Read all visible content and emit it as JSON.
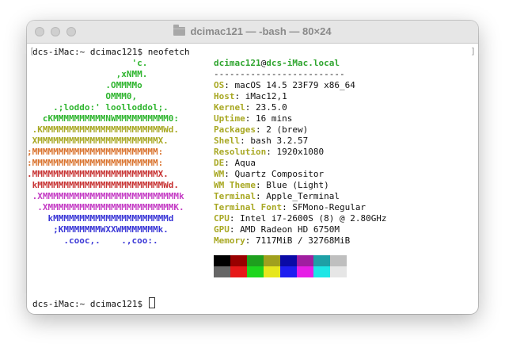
{
  "window": {
    "title": "dcimac121 — -bash — 80×24",
    "colors": {
      "titlebar": "#e6e6e6",
      "background": "#ffffff"
    }
  },
  "terminal": {
    "prompt_line": "dcs-iMac:~ dcimac121$ neofetch",
    "bracket_left": "[",
    "bracket_right": "]",
    "final_prompt": "dcs-iMac:~ dcimac121$",
    "art": [
      {
        "text": "                    'c.",
        "color": "#2fb52f"
      },
      {
        "text": "                 ,xNMM.",
        "color": "#2fb52f"
      },
      {
        "text": "               .OMMMMo",
        "color": "#2fb52f"
      },
      {
        "text": "               OMMM0,",
        "color": "#2fb52f"
      },
      {
        "text": "     .;loddo:' loolloddol;.",
        "color": "#2fb52f"
      },
      {
        "text": "   cKMMMMMMMMMMNWMMMMMMMMMM0:",
        "color": "#2fb52f"
      },
      {
        "text": " .KMMMMMMMMMMMMMMMMMMMMMMMWd.",
        "color": "#a8a823"
      },
      {
        "text": " XMMMMMMMMMMMMMMMMMMMMMMMX.",
        "color": "#a8a823"
      },
      {
        "text": ";MMMMMMMMMMMMMMMMMMMMMMMM:",
        "color": "#d9722c"
      },
      {
        "text": ":MMMMMMMMMMMMMMMMMMMMMMMM:",
        "color": "#d9722c"
      },
      {
        "text": ".MMMMMMMMMMMMMMMMMMMMMMMMX.",
        "color": "#c73232"
      },
      {
        "text": " kMMMMMMMMMMMMMMMMMMMMMMMMWd.",
        "color": "#c73232"
      },
      {
        "text": " .XMMMMMMMMMMMMMMMMMMMMMMMMMMk",
        "color": "#c43bc4"
      },
      {
        "text": "  .XMMMMMMMMMMMMMMMMMMMMMMMMK.",
        "color": "#c43bc4"
      },
      {
        "text": "    kMMMMMMMMMMMMMMMMMMMMMMd",
        "color": "#3a37d6"
      },
      {
        "text": "     ;KMMMMMMMWXXWMMMMMMMk.",
        "color": "#3a37d6"
      },
      {
        "text": "       .cooc,.    .,coo:.",
        "color": "#3a37d6"
      }
    ],
    "info": {
      "user": "dcimac121",
      "at": "@",
      "host": "dcs-iMac.local",
      "separator": "-------------------------",
      "rows": [
        {
          "key": "OS",
          "value": "macOS 14.5 23F79 x86_64"
        },
        {
          "key": "Host",
          "value": "iMac12,1"
        },
        {
          "key": "Kernel",
          "value": "23.5.0"
        },
        {
          "key": "Uptime",
          "value": "16 mins"
        },
        {
          "key": "Packages",
          "value": "2 (brew)"
        },
        {
          "key": "Shell",
          "value": "bash 3.2.57"
        },
        {
          "key": "Resolution",
          "value": "1920x1080"
        },
        {
          "key": "DE",
          "value": "Aqua"
        },
        {
          "key": "WM",
          "value": "Quartz Compositor"
        },
        {
          "key": "WM Theme",
          "value": "Blue (Light)"
        },
        {
          "key": "Terminal",
          "value": "Apple_Terminal"
        },
        {
          "key": "Terminal Font",
          "value": "SFMono-Regular"
        },
        {
          "key": "CPU",
          "value": "Intel i7-2600S (8) @ 2.80GHz"
        },
        {
          "key": "GPU",
          "value": "AMD Radeon HD 6750M"
        },
        {
          "key": "Memory",
          "value": "7117MiB / 32768MiB"
        }
      ],
      "palette_top": [
        "#000000",
        "#990000",
        "#1ea01e",
        "#a0a01e",
        "#0a0aa6",
        "#a01ea0",
        "#1ea0a6",
        "#bfbfbf"
      ],
      "palette_bottom": [
        "#666666",
        "#e61919",
        "#1ed61e",
        "#e6e61e",
        "#1e1ef0",
        "#e61ee6",
        "#1ee6e6",
        "#e6e6e6"
      ]
    }
  }
}
